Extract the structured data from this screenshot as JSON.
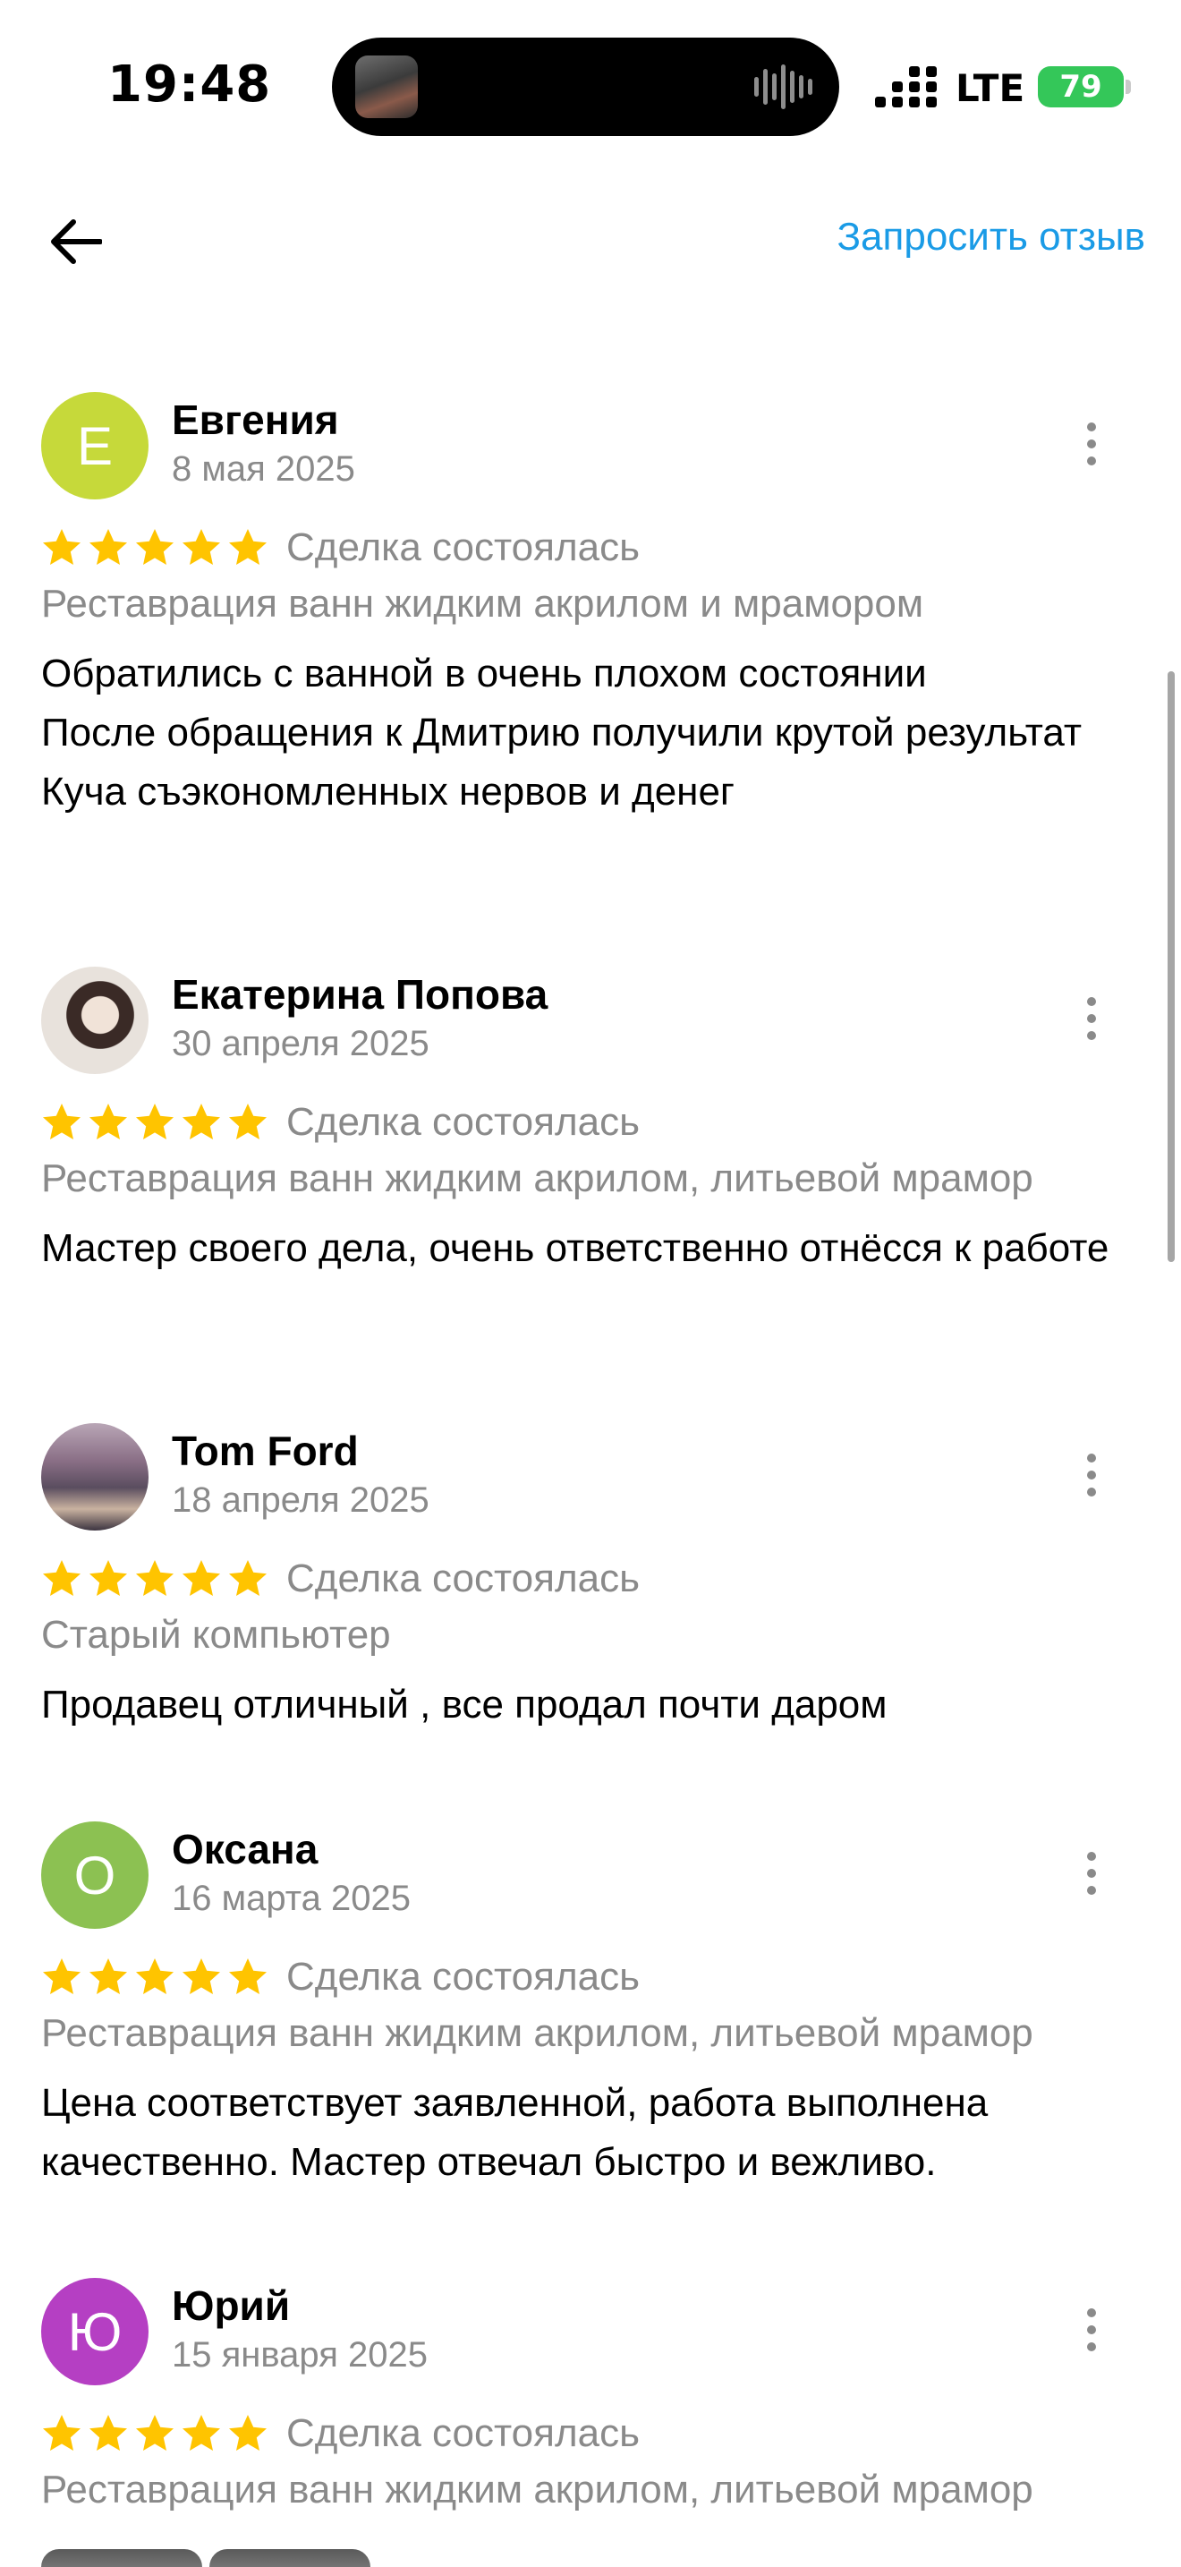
{
  "status_bar": {
    "time": "19:48",
    "network": "LTE",
    "battery": "79"
  },
  "top_bar": {
    "request_review_label": "Запросить отзыв"
  },
  "colors": {
    "accent": "#1a9be6",
    "star": "#ffc400",
    "muted_text": "#8a8a8a"
  },
  "reviews": [
    {
      "name": "Евгения",
      "date": "8 мая 2025",
      "avatar_letter": "Е",
      "avatar_color": "#c6d93a",
      "rating": 5,
      "status": "Сделка состоялась",
      "service": "Реставрация ванн жидким акрилом и мрамором",
      "text_lines": [
        "Обратились с ванной в очень плохом состоянии",
        "После обращения к Дмитрию получили крутой результат",
        "Куча съэкономленных нервов и денег"
      ]
    },
    {
      "name": "Екатерина Попова",
      "date": "30 апреля 2025",
      "avatar_letter": "",
      "avatar_color": "#d9d2c8",
      "rating": 5,
      "status": "Сделка состоялась",
      "service": "Реставрация ванн жидким акрилом, литьевой мрамор",
      "text_lines": [
        "Мастер своего дела, очень ответственно отнёсся к работе"
      ]
    },
    {
      "name": "Tom Ford",
      "date": "18 апреля 2025",
      "avatar_letter": "",
      "avatar_color": "#6f6070",
      "rating": 5,
      "status": "Сделка состоялась",
      "service": "Старый компьютер",
      "text_lines": [
        "Продавец отличный , все продал почти даром"
      ]
    },
    {
      "name": "Оксана",
      "date": "16 марта 2025",
      "avatar_letter": "О",
      "avatar_color": "#8cc152",
      "rating": 5,
      "status": "Сделка состоялась",
      "service": "Реставрация ванн жидким акрилом, литьевой мрамор",
      "text_lines": [
        "Цена соответствует заявленной, работа выполнена качественно. Мастер отвечал быстро и вежливо."
      ]
    },
    {
      "name": "Юрий",
      "date": "15 января 2025",
      "avatar_letter": "Ю",
      "avatar_color": "#b53fc3",
      "rating": 5,
      "status": "Сделка состоялась",
      "service": "Реставрация ванн жидким акрилом, литьевой мрамор",
      "text_lines": []
    }
  ]
}
